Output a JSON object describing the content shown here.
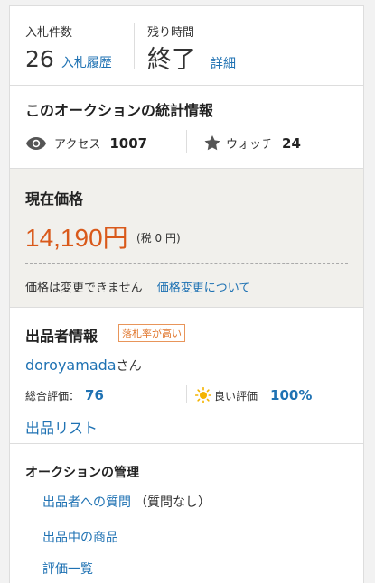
{
  "bids": {
    "label": "入札件数",
    "count": "26",
    "history_link": "入札履歴"
  },
  "time": {
    "label": "残り時間",
    "status": "終了",
    "detail_link": "詳細"
  },
  "stats": {
    "title": "このオークションの統計情報",
    "access_label": "アクセス",
    "access_value": "1007",
    "watch_label": "ウォッチ",
    "watch_value": "24"
  },
  "price": {
    "title": "現在価格",
    "amount": "14,190円",
    "tax": "(税 0 円)",
    "note": "価格は変更できません",
    "change_link": "価格変更について"
  },
  "seller": {
    "title": "出品者情報",
    "badge": "落札率が高い",
    "name": "doroyamada",
    "honorific": "さん",
    "total_label": "総合評価：",
    "total_value": "76",
    "good_label": "良い評価",
    "good_value": "100%",
    "list_link": "出品リスト"
  },
  "manage": {
    "title": "オークションの管理",
    "question_link": "出品者への質問",
    "question_note": "（質問なし）",
    "items_link": "出品中の商品",
    "review_link": "評価一覧"
  },
  "colors": {
    "link": "#1f72b3",
    "price": "#d9591a",
    "badge": "#e0762c"
  }
}
